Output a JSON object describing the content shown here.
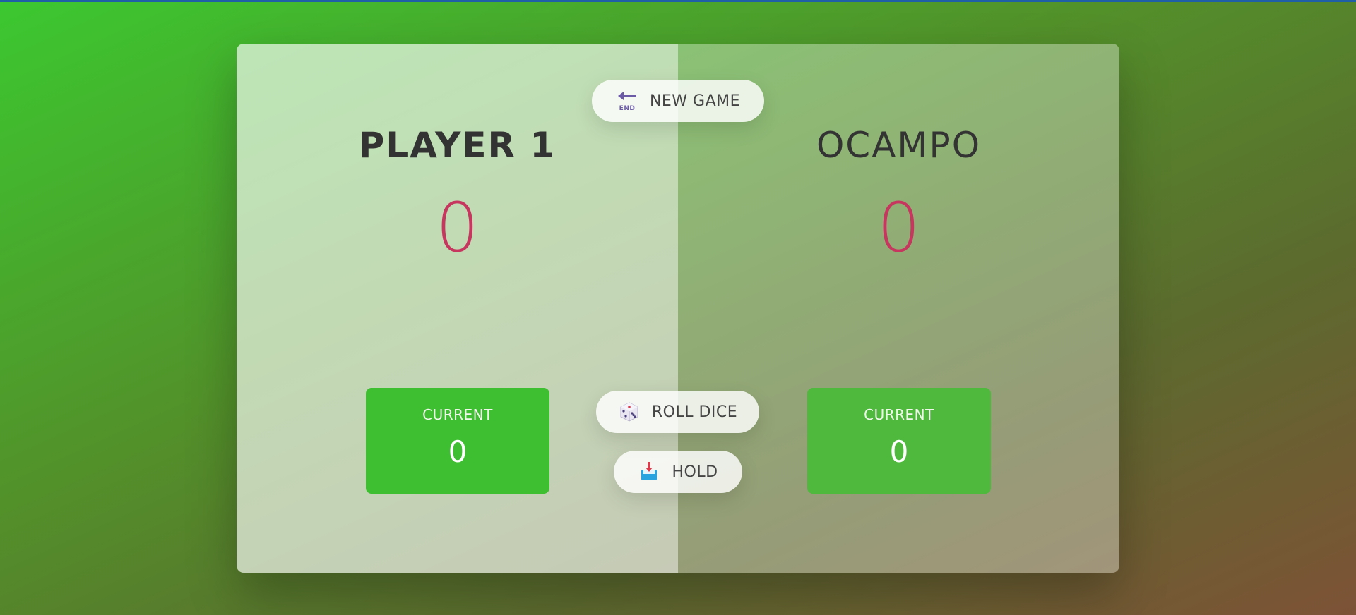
{
  "players": [
    {
      "name": "PLAYER 1",
      "score": "0",
      "current_label": "CURRENT",
      "current_score": "0",
      "active": true
    },
    {
      "name": "OCAMPO",
      "score": "0",
      "current_label": "CURRENT",
      "current_score": "0",
      "active": false
    }
  ],
  "buttons": {
    "new_game": {
      "label": "NEW GAME",
      "icon": "end-arrow-icon"
    },
    "roll_dice": {
      "label": "ROLL DICE",
      "icon": "dice-icon"
    },
    "hold": {
      "label": "HOLD",
      "icon": "inbox-tray-icon"
    }
  },
  "colors": {
    "score": "#c7365f",
    "current_box": "#3dbf31",
    "active_panel": "rgba(255,255,255,0.65)",
    "inactive_panel": "rgba(255,255,255,0.35)"
  }
}
